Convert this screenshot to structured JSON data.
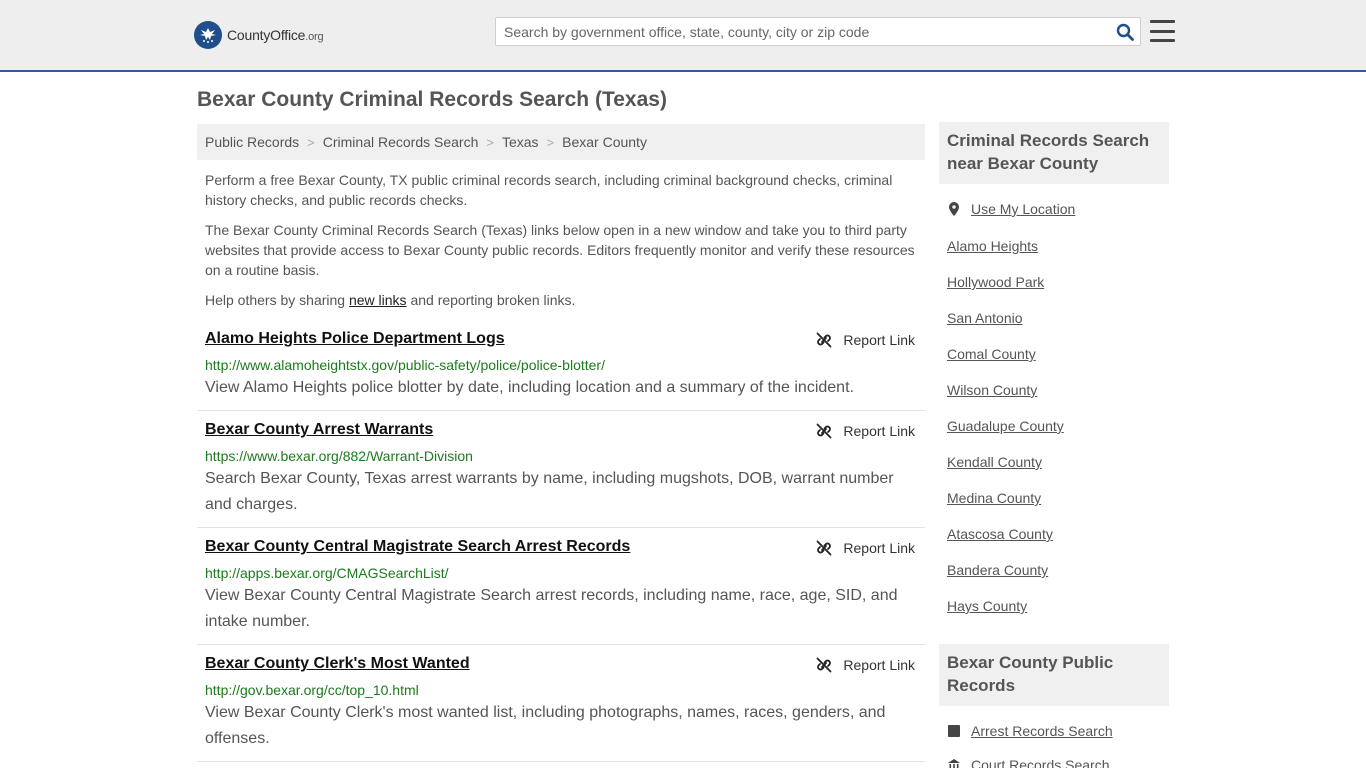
{
  "header": {
    "logo_name": "CountyOffice",
    "logo_tld": ".org",
    "search_placeholder": "Search by government office, state, county, city or zip code"
  },
  "page_title": "Bexar County Criminal Records Search (Texas)",
  "breadcrumb": [
    "Public Records",
    "Criminal Records Search",
    "Texas",
    "Bexar County"
  ],
  "intro": {
    "p1": "Perform a free Bexar County, TX public criminal records search, including criminal background checks, criminal history checks, and public records checks.",
    "p2": "The Bexar County Criminal Records Search (Texas) links below open in a new window and take you to third party websites that provide access to Bexar County public records. Editors frequently monitor and verify these resources on a routine basis.",
    "p3_before": "Help others by sharing ",
    "p3_link": "new links",
    "p3_after": " and reporting broken links."
  },
  "report_label": "Report Link",
  "results": [
    {
      "title": "Alamo Heights Police Department Logs",
      "url": "http://www.alamoheightstx.gov/public-safety/police/police-blotter/",
      "desc": "View Alamo Heights police blotter by date, including location and a summary of the incident."
    },
    {
      "title": "Bexar County Arrest Warrants",
      "url": "https://www.bexar.org/882/Warrant-Division",
      "desc": "Search Bexar County, Texas arrest warrants by name, including mugshots, DOB, warrant number and charges."
    },
    {
      "title": "Bexar County Central Magistrate Search Arrest Records",
      "url": "http://apps.bexar.org/CMAGSearchList/",
      "desc": "View Bexar County Central Magistrate Search arrest records, including name, race, age, SID, and intake number."
    },
    {
      "title": "Bexar County Clerk's Most Wanted",
      "url": "http://gov.bexar.org/cc/top_10.html",
      "desc": "View Bexar County Clerk's most wanted list, including photographs, names, races, genders, and offenses."
    }
  ],
  "sidebar": {
    "nearby_title": "Criminal Records Search near Bexar County",
    "use_location": "Use My Location",
    "nearby": [
      "Alamo Heights",
      "Hollywood Park",
      "San Antonio",
      "Comal County",
      "Wilson County",
      "Guadalupe County",
      "Kendall County",
      "Medina County",
      "Atascosa County",
      "Bandera County",
      "Hays County"
    ],
    "public_title": "Bexar County Public Records",
    "public_links": [
      "Arrest Records Search",
      "Court Records Search"
    ]
  },
  "colors": {
    "brand_blue": "#1f4e8b",
    "url_green": "#1e7a1e",
    "header_border": "#2c5d94"
  }
}
